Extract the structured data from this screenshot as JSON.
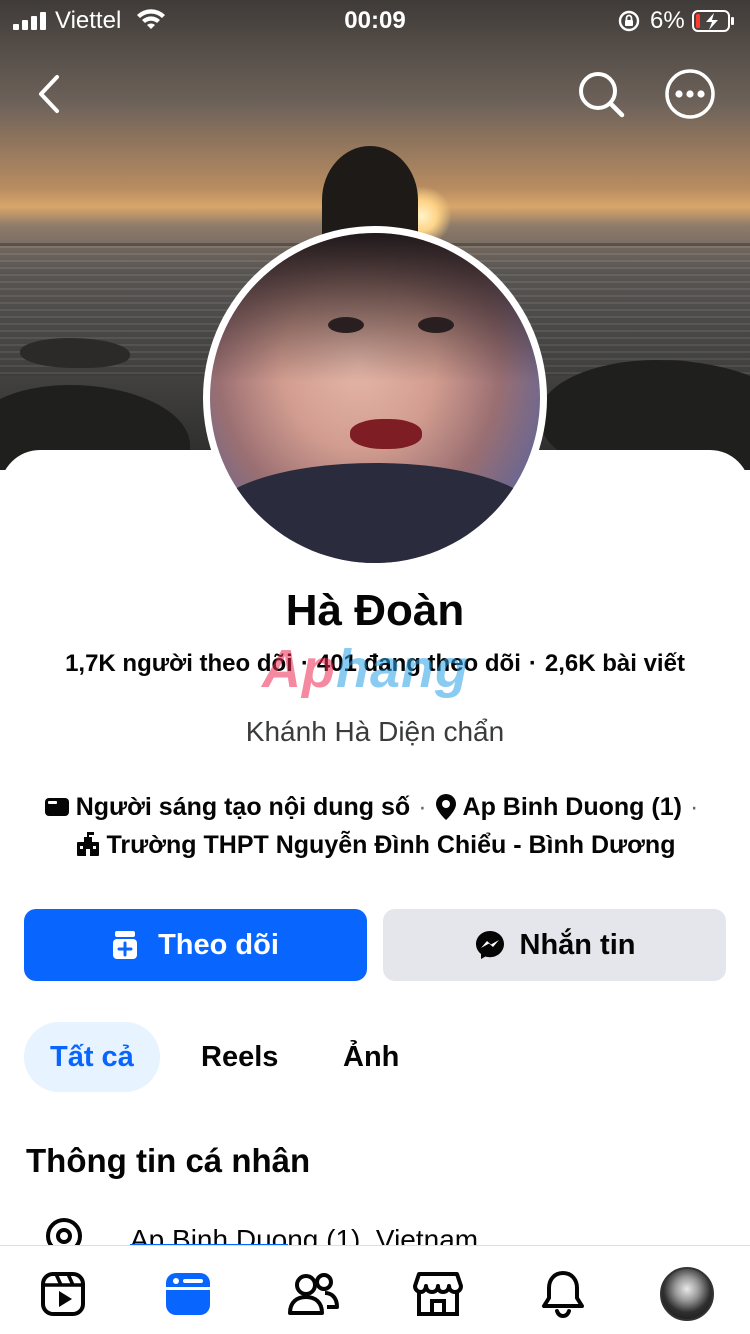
{
  "status_bar": {
    "carrier": "Viettel",
    "time": "00:09",
    "battery_percent": "6%"
  },
  "profile": {
    "name": "Hà Đoàn",
    "followers": "1,7K người theo dõi",
    "following": "401 đang theo dõi",
    "posts": "2,6K bài viết",
    "stats_separator": "·",
    "bio": "Khánh Hà Diện chẩn",
    "details": {
      "category": "Người sáng tạo nội dung số",
      "location": "Ap Binh Duong (1)",
      "school": "Trường THPT Nguyễn Đình Chiểu - Bình Dương",
      "separator": "·"
    }
  },
  "watermark": {
    "part1": "Ap",
    "part2": "hang"
  },
  "actions": {
    "follow_label": "Theo dõi",
    "message_label": "Nhắn tin"
  },
  "tabs": [
    {
      "label": "Tất cả",
      "selected": true
    },
    {
      "label": "Reels",
      "selected": false
    },
    {
      "label": "Ảnh",
      "selected": false
    }
  ],
  "about": {
    "title": "Thông tin cá nhân",
    "location_row": "Ap Binh Duong (1), Vietnam"
  },
  "bottom_nav": [
    {
      "icon": "reels-icon"
    },
    {
      "icon": "feed-icon",
      "active": true
    },
    {
      "icon": "friends-icon"
    },
    {
      "icon": "marketplace-icon"
    },
    {
      "icon": "notifications-icon"
    },
    {
      "icon": "profile-avatar"
    }
  ],
  "colors": {
    "accent": "#0866ff",
    "accent_light": "#e7f3ff",
    "secondary_button": "#e4e6eb",
    "text": "#050505"
  }
}
